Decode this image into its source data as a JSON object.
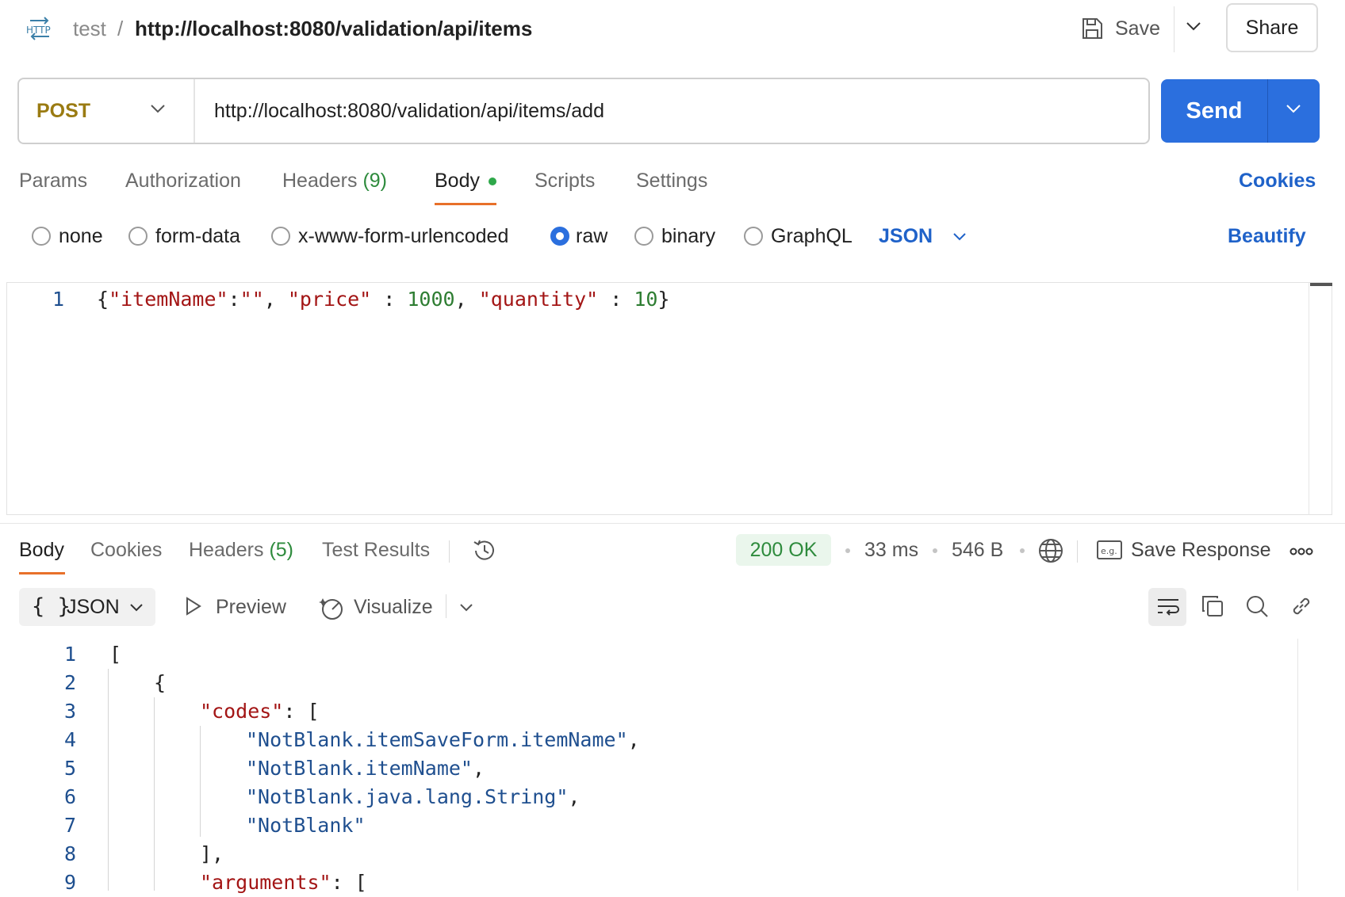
{
  "header": {
    "protocol_badge": "HTTP",
    "breadcrumb_parent": "test",
    "breadcrumb_sep": "/",
    "title": "http://localhost:8080/validation/api/items",
    "save_label": "Save",
    "share_label": "Share"
  },
  "request": {
    "method": "POST",
    "url": "http://localhost:8080/validation/api/items/add",
    "send_label": "Send"
  },
  "request_tabs": {
    "params": "Params",
    "authorization": "Authorization",
    "headers": "Headers",
    "headers_count": "(9)",
    "body": "Body",
    "scripts": "Scripts",
    "settings": "Settings",
    "cookies": "Cookies"
  },
  "body_types": {
    "none": "none",
    "form_data": "form-data",
    "urlencoded": "x-www-form-urlencoded",
    "raw": "raw",
    "binary": "binary",
    "graphql": "GraphQL",
    "selected": "raw",
    "language": "JSON",
    "beautify": "Beautify"
  },
  "request_body": {
    "line_no": "1",
    "open_brace": "{",
    "k1": "\"itemName\"",
    "colon1": ":",
    "v1": "\"\"",
    "sep1": ", ",
    "k2": "\"price\"",
    "colon2": " : ",
    "v2": "1000",
    "sep2": ", ",
    "k3": "\"quantity\"",
    "colon3": " : ",
    "v3": "10",
    "close_brace": "}"
  },
  "response_tabs": {
    "body": "Body",
    "cookies": "Cookies",
    "headers": "Headers",
    "headers_count": "(5)",
    "test_results": "Test Results"
  },
  "response_meta": {
    "status": "200 OK",
    "time": "33 ms",
    "size": "546 B",
    "save_response": "Save Response",
    "eg_badge": "e.g."
  },
  "response_toolbar": {
    "format_braces": "{ }",
    "format": "JSON",
    "preview": "Preview",
    "visualize": "Visualize"
  },
  "response_body": {
    "line_numbers": [
      "1",
      "2",
      "3",
      "4",
      "5",
      "6",
      "7",
      "8",
      "9"
    ],
    "l1": "[",
    "l2": "{",
    "l3_key": "\"codes\"",
    "l3_rest": ": [",
    "l4_str": "\"NotBlank.itemSaveForm.itemName\"",
    "l4_comma": ",",
    "l5_str": "\"NotBlank.itemName\"",
    "l5_comma": ",",
    "l6_str": "\"NotBlank.java.lang.String\"",
    "l6_comma": ",",
    "l7_str": "\"NotBlank\"",
    "l8": "],",
    "l9_key": "\"arguments\"",
    "l9_rest": ": ["
  },
  "colors": {
    "accent": "#2b6fde",
    "method": "#9a7b12",
    "tab_underline": "#e8702a",
    "status_ok": "#2e8b3d",
    "json_key": "#a31515",
    "json_number": "#2e7d32",
    "json_string": "#1f4f8f"
  }
}
